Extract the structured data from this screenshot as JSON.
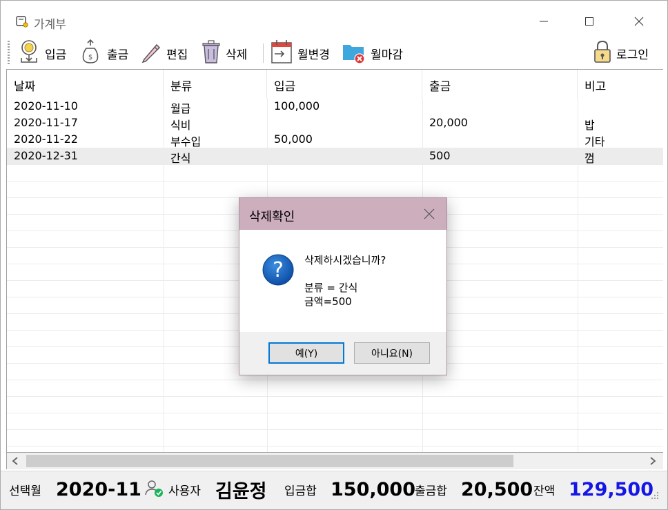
{
  "window": {
    "title": "가계부"
  },
  "toolbar": {
    "items": [
      {
        "label": "입금",
        "icon": "deposit-icon"
      },
      {
        "label": "출금",
        "icon": "withdraw-icon"
      },
      {
        "label": "편집",
        "icon": "pencil-icon"
      },
      {
        "label": "삭제",
        "icon": "trash-icon"
      },
      {
        "label": "월변경",
        "icon": "calendar-icon"
      },
      {
        "label": "월마감",
        "icon": "folder-close-icon"
      },
      {
        "label": "로그인",
        "icon": "lock-icon"
      }
    ]
  },
  "grid": {
    "columns": [
      "날짜",
      "분류",
      "입금",
      "출금",
      "비고"
    ],
    "rows": [
      {
        "date": "2020-11-10",
        "category": "월급",
        "deposit": "100,000",
        "withdraw": "",
        "note": ""
      },
      {
        "date": "2020-11-17",
        "category": "식비",
        "deposit": "",
        "withdraw": "20,000",
        "note": "밥"
      },
      {
        "date": "2020-11-22",
        "category": "부수입",
        "deposit": "50,000",
        "withdraw": "",
        "note": "기타"
      },
      {
        "date": "2020-12-31",
        "category": "간식",
        "deposit": "",
        "withdraw": "500",
        "note": "껌"
      }
    ],
    "selected_row": 3
  },
  "status": {
    "month_label": "선택월",
    "month_value": "2020-11",
    "user_label": "사용자",
    "user_value": "김윤정",
    "deposit_sum_label": "입금합",
    "deposit_sum_value": "150,000",
    "withdraw_sum_label": "출금합",
    "withdraw_sum_value": "20,500",
    "balance_label": "잔액",
    "balance_value": "129,500"
  },
  "dialog": {
    "title": "삭제확인",
    "message": [
      "삭제하시겠습니까?",
      "",
      "분류 = 간식",
      "금액=500"
    ],
    "yes_label": "예(Y)",
    "no_label": "아니요(N)"
  },
  "colors": {
    "dialog_title_bg": "#ccaebc",
    "balance": "#1515e6",
    "selected_row_bg": "#ececec",
    "default_button_border": "#0078d7"
  }
}
